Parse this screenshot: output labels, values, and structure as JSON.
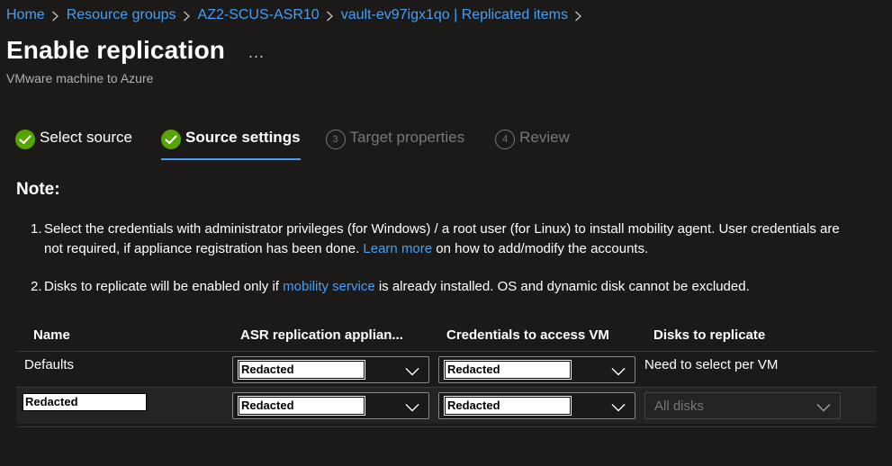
{
  "breadcrumb": [
    "Home",
    "Resource groups",
    "AZ2-SCUS-ASR10",
    "vault-ev97igx1qo | Replicated items"
  ],
  "header": {
    "title": "Enable replication",
    "more": "...",
    "subtitle": "VMware machine to Azure"
  },
  "steps": [
    {
      "label": "Select source",
      "state": "done"
    },
    {
      "label": "Source settings",
      "state": "current"
    },
    {
      "number": "3",
      "label": "Target properties",
      "state": "pending"
    },
    {
      "number": "4",
      "label": "Review",
      "state": "pending"
    }
  ],
  "note": {
    "heading": "Note:",
    "item1": {
      "num": "1.",
      "text_a": "Select the credentials with administrator privileges (for Windows) / a root user (for Linux) to install mobility agent. User credentials are not required, if appliance registration has been done. ",
      "link": "Learn more",
      "text_b": " on how to add/modify the accounts."
    },
    "item2": {
      "num": "2.",
      "text_a": "Disks to replicate will be enabled only if ",
      "link": "mobility service",
      "text_b": " is already installed. OS and dynamic disk cannot be excluded."
    }
  },
  "grid": {
    "columns": [
      "Name",
      "ASR replication applian...",
      "Credentials to access VM",
      "Disks to replicate"
    ],
    "rows": [
      {
        "name": "Defaults",
        "appliance": "Redacted",
        "credentials": "Redacted",
        "disks": "Need to select per VM"
      },
      {
        "name": "Redacted",
        "appliance": "Redacted",
        "credentials": "Redacted",
        "disks": "All disks"
      }
    ]
  },
  "colors": {
    "accent": "#479ef5",
    "success": "#57a300",
    "background": "#1b1a19"
  },
  "icons": {
    "separator": "chevron-right-icon",
    "dropdown": "chevron-down-icon",
    "done": "checkmark-circle-icon"
  }
}
